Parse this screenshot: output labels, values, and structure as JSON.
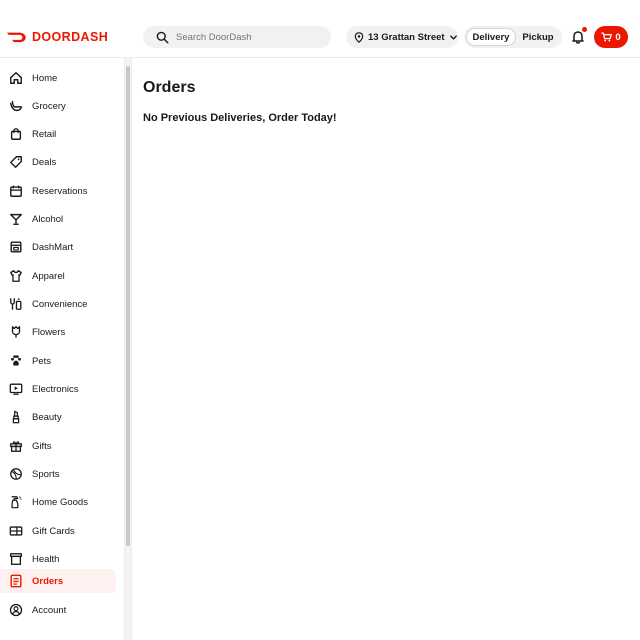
{
  "brand": {
    "name": "DOORDASH",
    "color": "#eb1700"
  },
  "search": {
    "placeholder": "Search DoorDash",
    "icon": "search-icon"
  },
  "address": {
    "label": "13 Grattan Street",
    "icon": "location-pin-icon"
  },
  "mode_toggle": {
    "delivery": "Delivery",
    "pickup": "Pickup",
    "selected": "Delivery"
  },
  "notifications": {
    "icon": "bell-icon",
    "has_unread": true
  },
  "cart": {
    "count": "0",
    "icon": "cart-icon"
  },
  "sidebar": {
    "items": [
      {
        "label": "Home",
        "icon": "home-icon"
      },
      {
        "label": "Grocery",
        "icon": "grocery-icon"
      },
      {
        "label": "Retail",
        "icon": "shopping-bag-icon"
      },
      {
        "label": "Deals",
        "icon": "tag-icon"
      },
      {
        "label": "Reservations",
        "icon": "calendar-icon"
      },
      {
        "label": "Alcohol",
        "icon": "cocktail-icon"
      },
      {
        "label": "DashMart",
        "icon": "store-icon"
      },
      {
        "label": "Apparel",
        "icon": "shirt-icon"
      },
      {
        "label": "Convenience",
        "icon": "convenience-icon"
      },
      {
        "label": "Flowers",
        "icon": "flower-icon"
      },
      {
        "label": "Pets",
        "icon": "paw-icon"
      },
      {
        "label": "Electronics",
        "icon": "electronics-icon"
      },
      {
        "label": "Beauty",
        "icon": "lipstick-icon"
      },
      {
        "label": "Gifts",
        "icon": "gift-icon"
      },
      {
        "label": "Sports",
        "icon": "ball-icon"
      },
      {
        "label": "Home Goods",
        "icon": "spray-bottle-icon"
      },
      {
        "label": "Gift Cards",
        "icon": "gift-card-icon"
      },
      {
        "label": "Health",
        "icon": "health-icon"
      },
      {
        "label": "Orders",
        "icon": "receipt-icon",
        "active": true
      },
      {
        "label": "Account",
        "icon": "account-icon"
      }
    ]
  },
  "main": {
    "title": "Orders",
    "empty_message": "No Previous Deliveries, Order Today!"
  }
}
